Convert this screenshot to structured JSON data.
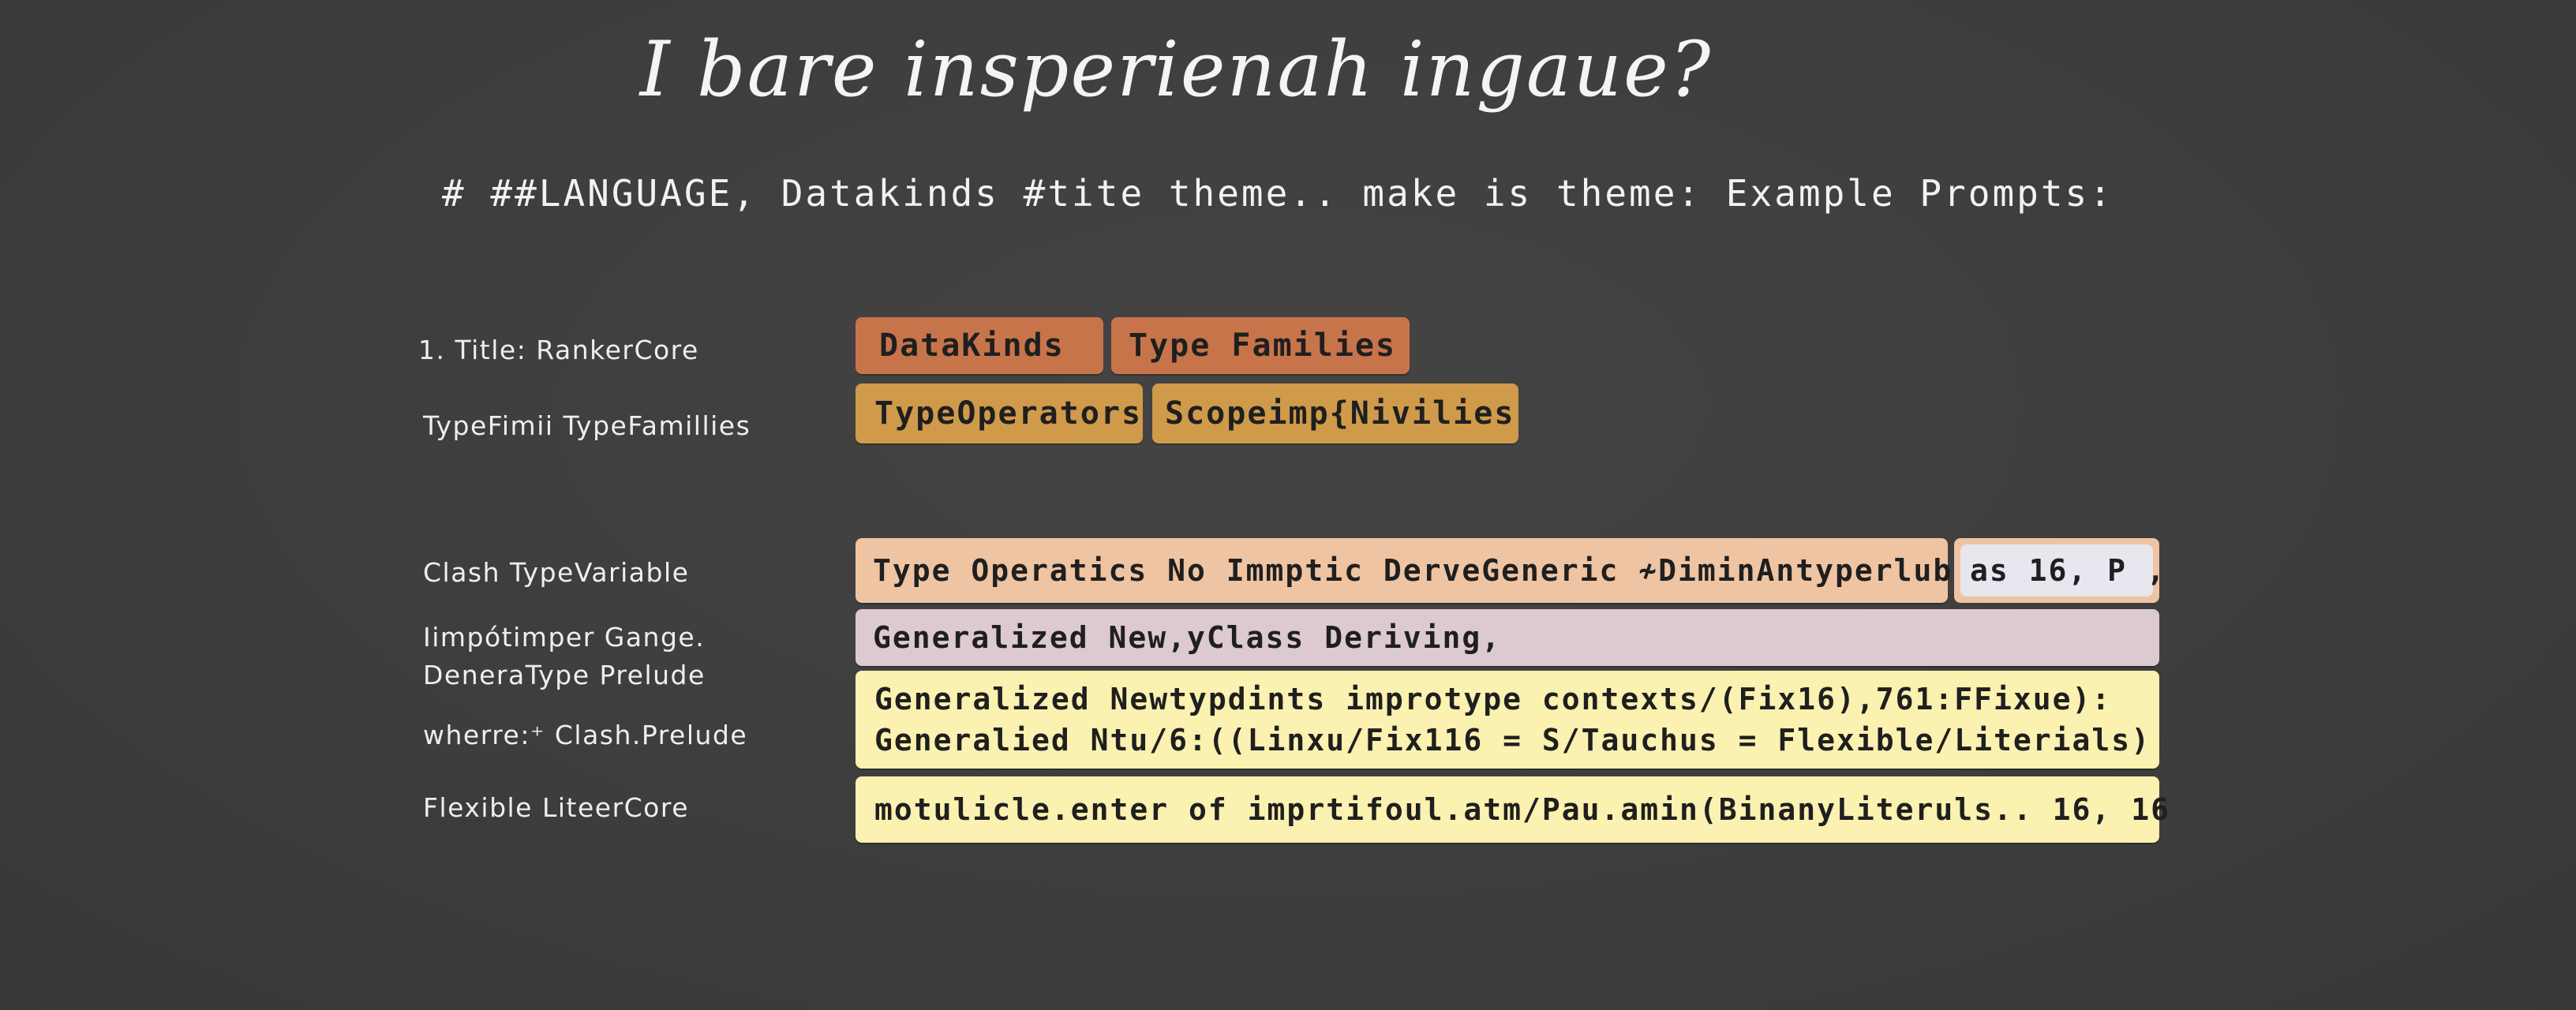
{
  "title": "I bare insperienah ingaue?",
  "subtitle": "#  ##LANGUAGE, Datakinds #tite theme.. make is theme: Example Prompts:",
  "labels": [
    "1. Title: RankerCore",
    "TypeFimii TypeFamillies",
    "Clash TypeVariable",
    "Iimpótimper Gange.",
    "DeneraType Prelude",
    "wherre:⁺ Clash.Prelude",
    "Flexible LiteerCore"
  ],
  "chips": {
    "datakinds": "DataKinds",
    "type_families": "Type Families",
    "type_operators": "TypeOperators",
    "scope": "Scopeimp{Nivilies",
    "type_operatics": "Type Operatics No Immptic DerveGeneric ≁DiminAntyperlube.",
    "as16": "as 16, P ,",
    "generalized_new": "Generalized New,yClass Deriving,",
    "generalized_line1": "Generalized Newtypdints improtype contexts/(Fix16),761:FFixue):",
    "generalized_line2": "Generalied Ntu/6:((Linxu/Fix116 = S/Tauchus = Flexible/Literials)",
    "motulicle": "motulicle.enter of imprtifoul.atm/Pau.amin(BinanyLiteruls.. 16, 16"
  },
  "colors": {
    "background": "#3f3f3f",
    "orange": "#c8744a",
    "amber": "#cf9a4a",
    "peach": "#efc4a2",
    "lavender": "#e8e6ef",
    "mauve": "#ddc9d0",
    "yellow": "#fbf1b0"
  }
}
